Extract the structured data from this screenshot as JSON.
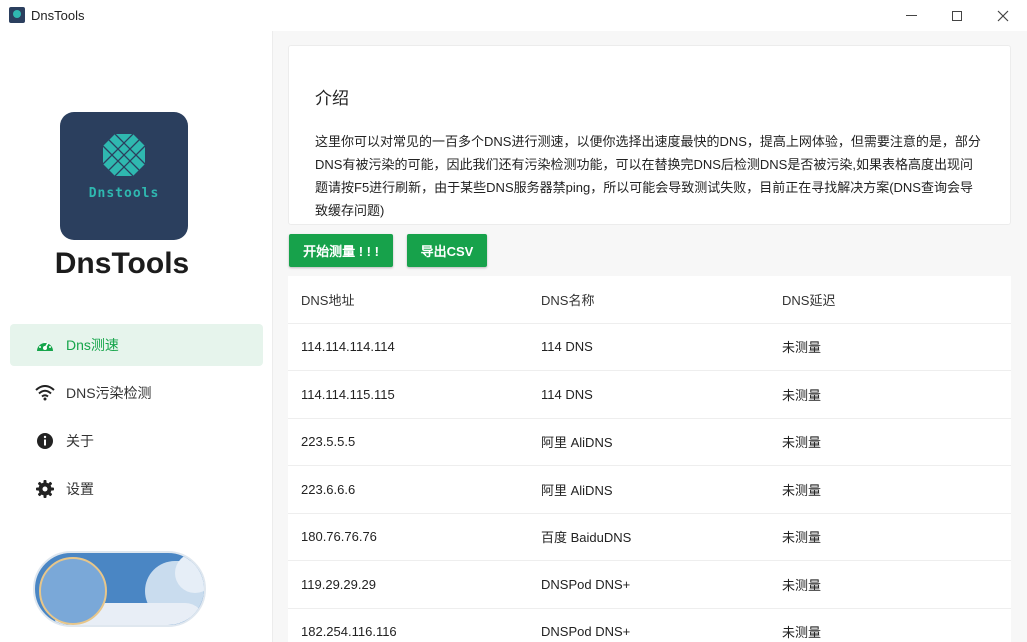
{
  "window": {
    "title": "DnsTools"
  },
  "sidebar": {
    "logo_text": "Dnstools",
    "app_name": "DnsTools",
    "nav": [
      {
        "label": "Dns测速",
        "icon": "speedometer-icon",
        "active": true
      },
      {
        "label": "DNS污染检测",
        "icon": "wifi-icon",
        "active": false
      },
      {
        "label": "关于",
        "icon": "info-icon",
        "active": false
      },
      {
        "label": "设置",
        "icon": "gear-icon",
        "active": false
      }
    ],
    "theme_toggle_state": "light"
  },
  "intro": {
    "title": "介绍",
    "text": "这里你可以对常见的一百多个DNS进行测速，以便你选择出速度最快的DNS，提高上网体验，但需要注意的是，部分DNS有被污染的可能，因此我们还有污染检测功能，可以在替换完DNS后检测DNS是否被污染,如果表格高度出现问题请按F5进行刷新，由于某些DNS服务器禁ping，所以可能会导致测试失败，目前正在寻找解决方案(DNS查询会导致缓存问题)"
  },
  "actions": {
    "start_label": "开始测量 ! ! !",
    "export_label": "导出CSV"
  },
  "table": {
    "headers": [
      "DNS地址",
      "DNS名称",
      "DNS延迟"
    ],
    "rows": [
      [
        "114.114.114.114",
        "114 DNS",
        "未测量"
      ],
      [
        "114.114.115.115",
        "114 DNS",
        "未测量"
      ],
      [
        "223.5.5.5",
        "阿里 AliDNS",
        "未测量"
      ],
      [
        "223.6.6.6",
        "阿里 AliDNS",
        "未测量"
      ],
      [
        "180.76.76.76",
        "百度 BaiduDNS",
        "未测量"
      ],
      [
        "119.29.29.29",
        "DNSPod DNS+",
        "未测量"
      ],
      [
        "182.254.116.116",
        "DNSPod DNS+",
        "未测量"
      ]
    ]
  },
  "colors": {
    "accent": "#17a24b",
    "active_nav_bg": "#e6f4ec",
    "logo_bg": "#2b3f5e",
    "logo_teal": "#2fb8b0"
  }
}
